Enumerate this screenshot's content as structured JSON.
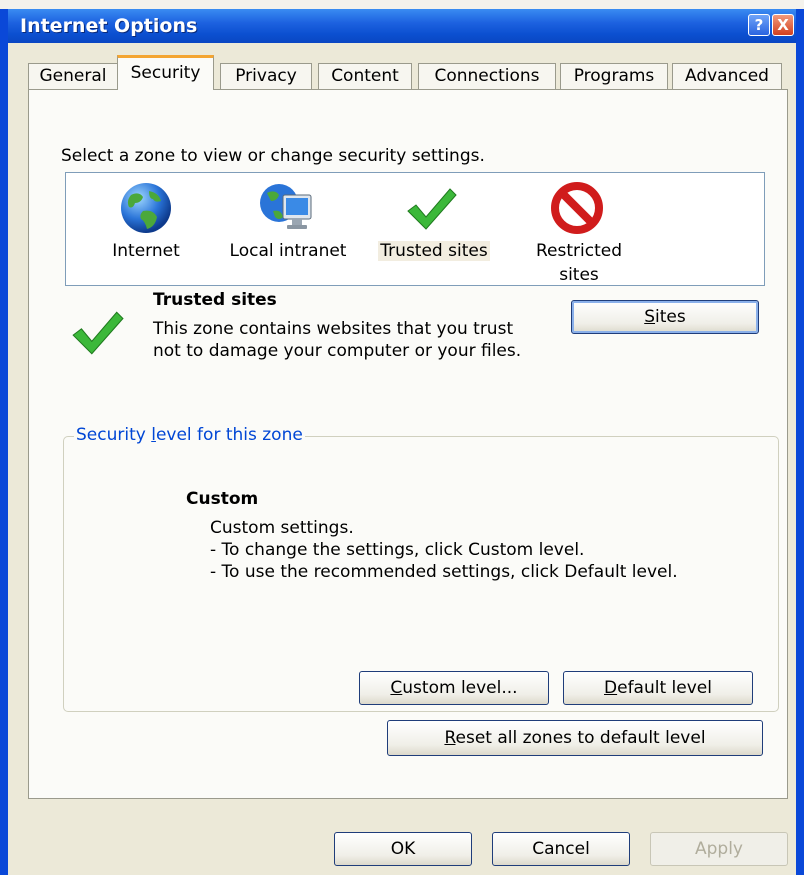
{
  "window": {
    "title": "Internet Options"
  },
  "titlebar": {
    "help_glyph": "?",
    "close_glyph": "X"
  },
  "tabs": [
    {
      "label": "General"
    },
    {
      "label": "Security",
      "active": true
    },
    {
      "label": "Privacy"
    },
    {
      "label": "Content"
    },
    {
      "label": "Connections"
    },
    {
      "label": "Programs"
    },
    {
      "label": "Advanced"
    }
  ],
  "security": {
    "zone_intro": "Select a zone to view or change security settings.",
    "zones": [
      {
        "label": "Internet",
        "icon": "globe-icon"
      },
      {
        "label": "Local intranet",
        "icon": "network-computer-icon"
      },
      {
        "label": "Trusted sites",
        "icon": "checkmark-icon",
        "selected": true
      },
      {
        "label_line1": "Restricted",
        "label_line2": "sites",
        "icon": "blocked-icon"
      }
    ],
    "selected_zone": {
      "title": "Trusted sites",
      "description": "This zone contains websites that you trust not to damage your computer or your files."
    },
    "sites_button": {
      "mnemonic": "S",
      "rest": "ites"
    },
    "level_group": {
      "legend_pre": "Security ",
      "legend_mnemonic": "l",
      "legend_post": "evel for this zone",
      "level_name": "Custom",
      "level_lines": [
        "Custom settings.",
        "- To change the settings, click Custom level.",
        "- To use the recommended settings, click Default level."
      ],
      "custom_level_button": {
        "mnemonic": "C",
        "rest": "ustom level..."
      },
      "default_level_button": {
        "mnemonic": "D",
        "rest": "efault level"
      }
    },
    "reset_button": {
      "mnemonic": "R",
      "rest": "eset all zones to default level"
    }
  },
  "footer": {
    "ok": "OK",
    "cancel": "Cancel",
    "apply": "Apply"
  },
  "colors": {
    "titlebar": "#0a48d8",
    "active_tab_accent": "#f4a531",
    "legend_text": "#0046d5",
    "check_green": "#3cb83a",
    "blocked_red": "#d01c1c"
  }
}
